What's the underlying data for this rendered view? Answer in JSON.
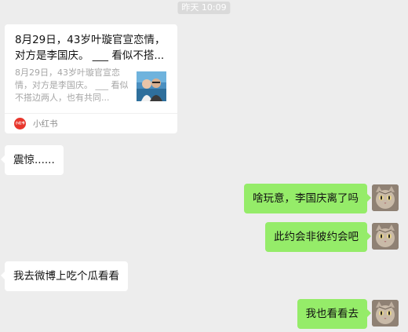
{
  "chat": {
    "timestamp": "昨天 10:09",
    "card": {
      "title": "8月29日，43岁叶璇官宣恋情，对方是李国庆。 ___ 看似不搭...",
      "description": "8月29日，43岁叶璇官宣恋情，对方是李国庆。 ___ 看似不搭边两人，也有共同...",
      "source_logo_text": "小红书",
      "source_name": "小红书",
      "source_color": "#e8362c"
    },
    "messages": [
      {
        "side": "left",
        "text": "震惊......"
      },
      {
        "side": "right",
        "text": "啥玩意，李国庆离了吗"
      },
      {
        "side": "right",
        "text": "此约会非彼约会吧"
      },
      {
        "side": "left",
        "text": "我去微博上吃个瓜看看"
      },
      {
        "side": "right",
        "text": "我也看看去"
      }
    ],
    "colors": {
      "background": "#ededed",
      "self_bubble": "#95ec69",
      "other_bubble": "#ffffff"
    }
  }
}
